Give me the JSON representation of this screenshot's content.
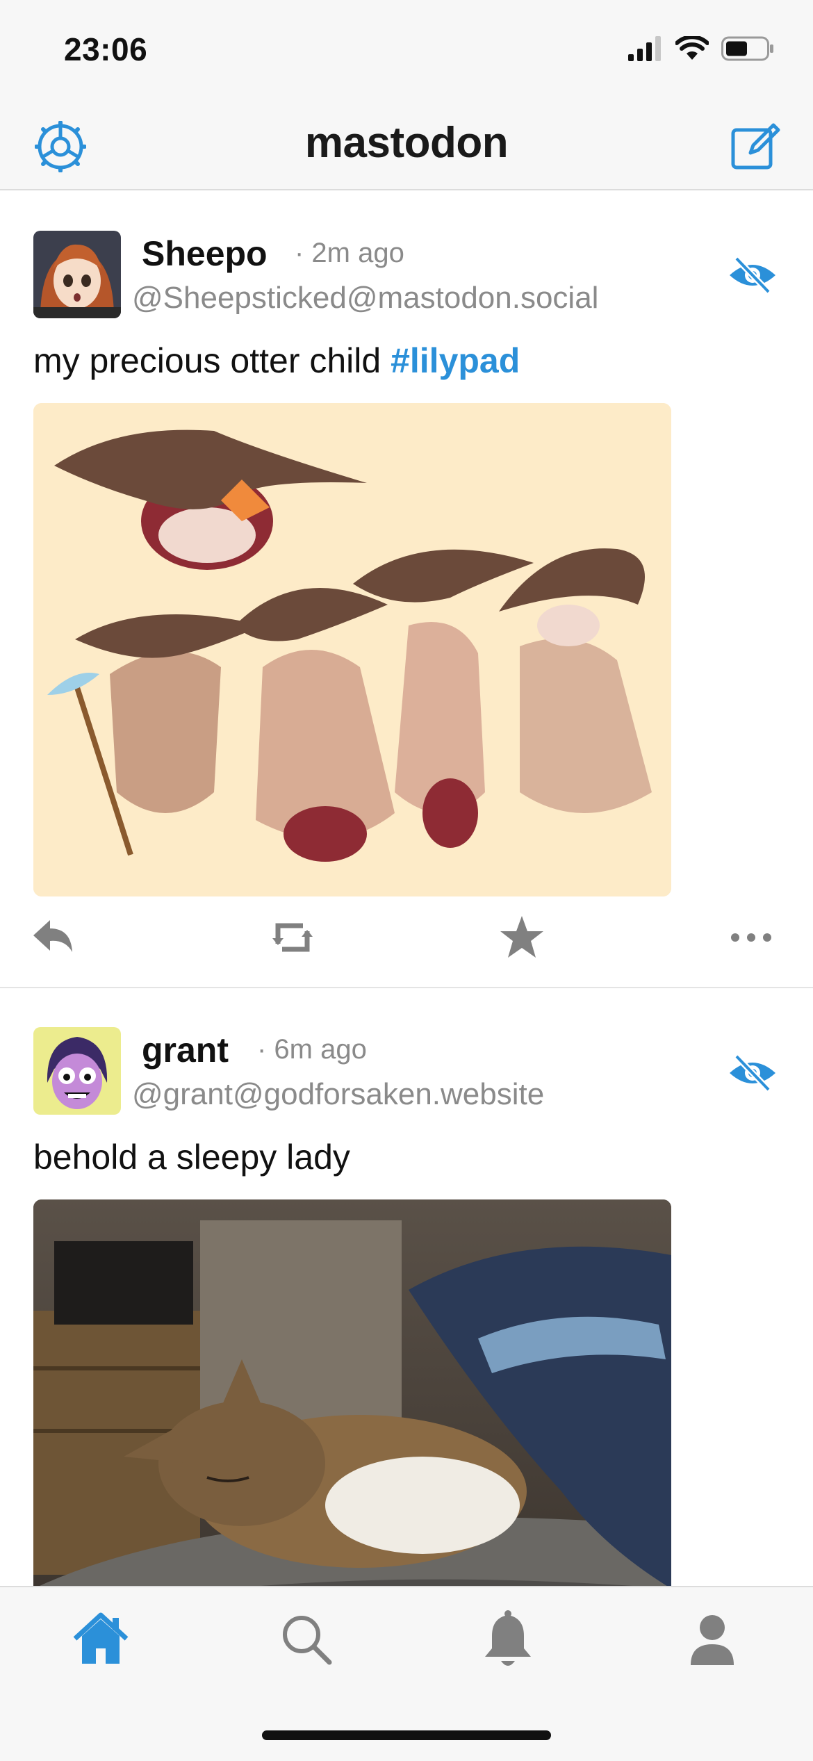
{
  "status_bar": {
    "time": "23:06",
    "icons": [
      "signal-icon",
      "wifi-icon",
      "battery-icon"
    ]
  },
  "nav": {
    "title": "mastodon",
    "left_icon": "gear-icon",
    "right_icon": "compose-icon"
  },
  "posts": [
    {
      "display_name": "Sheepo",
      "time_ago": "· 2m ago",
      "handle": "@Sheepsticked@mastodon.social",
      "content_text": "my precious otter child ",
      "hashtag": "#lilypad",
      "media_icon": "illustration-image"
    },
    {
      "display_name": "grant",
      "time_ago": "· 6m ago",
      "handle": "@grant@godforsaken.website",
      "content_text": "behold a sleepy lady",
      "hashtag": "",
      "media_icon": "photo-image"
    }
  ],
  "post_actions": [
    "reply-icon",
    "boost-icon",
    "favourite-icon",
    "more-icon"
  ],
  "tabs": [
    "home-icon",
    "search-icon",
    "notifications-icon",
    "profile-icon"
  ],
  "colors": {
    "accent": "#2b90d9",
    "muted": "#8a8a8a",
    "bar_bg": "#f7f7f7"
  }
}
